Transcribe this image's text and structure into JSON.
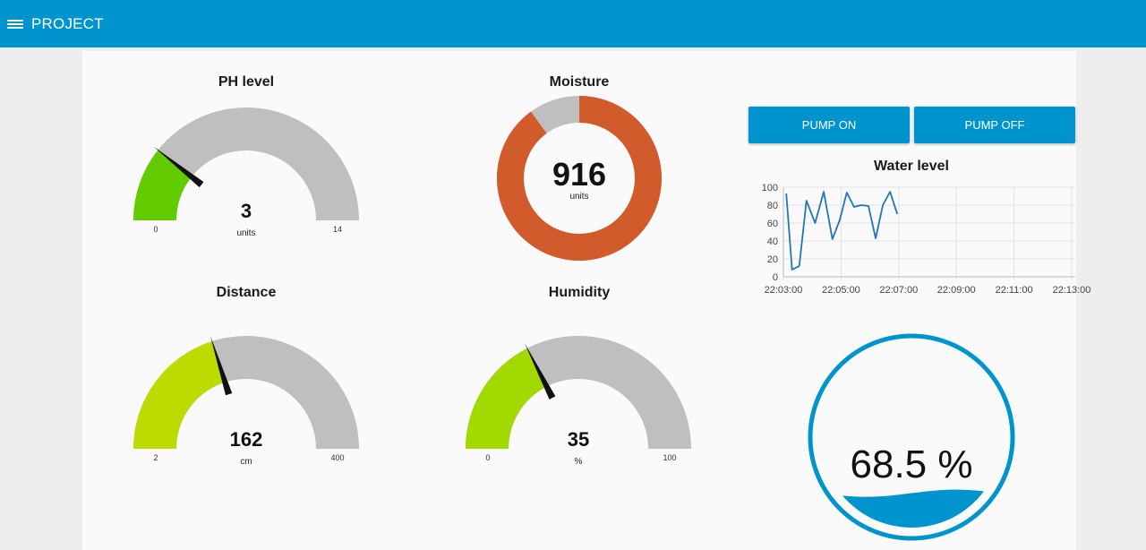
{
  "header": {
    "title": "PROJECT",
    "menu_icon": "hamburger-menu-icon",
    "color": "#0094ce"
  },
  "gauges": {
    "ph": {
      "title": "PH level",
      "value": 3,
      "units": "units",
      "min": 0,
      "max": 14,
      "min_label": "0",
      "max_label": "14",
      "color": "#63cc00"
    },
    "moisture": {
      "title": "Moisture",
      "value": 916,
      "units": "units",
      "fraction": 0.9,
      "color": "#d15b2b"
    },
    "distance": {
      "title": "Distance",
      "value": 162,
      "units": "cm",
      "min": 2,
      "max": 400,
      "min_label": "2",
      "max_label": "400",
      "color": "#bedb00"
    },
    "humidity": {
      "title": "Humidity",
      "value": 35,
      "units": "%",
      "min": 0,
      "max": 100,
      "min_label": "0",
      "max_label": "100",
      "color": "#a2d900"
    }
  },
  "controls": {
    "pump_on_label": "PUMP ON",
    "pump_off_label": "PUMP OFF"
  },
  "chart_data": {
    "type": "line",
    "title": "Water level",
    "ylim": [
      0,
      100
    ],
    "yticks": [
      0,
      20,
      40,
      60,
      80,
      100
    ],
    "xticks": [
      "22:03:00",
      "22:05:00",
      "22:07:00",
      "22:09:00",
      "22:11:00",
      "22:13:00"
    ],
    "x_range_minutes": [
      0,
      10
    ],
    "grid": true,
    "series": [
      {
        "color": "#1f77b4",
        "x": [
          0.1,
          0.3,
          0.55,
          0.8,
          1.1,
          1.4,
          1.7,
          1.95,
          2.2,
          2.45,
          2.7,
          2.95,
          3.2,
          3.45,
          3.7,
          3.95
        ],
        "values": [
          93,
          8,
          12,
          85,
          60,
          95,
          42,
          63,
          94,
          78,
          80,
          79,
          43,
          80,
          95,
          70
        ]
      }
    ]
  },
  "tank": {
    "value": "68.5 %",
    "fraction": 0.685,
    "color": "#0094ce"
  }
}
